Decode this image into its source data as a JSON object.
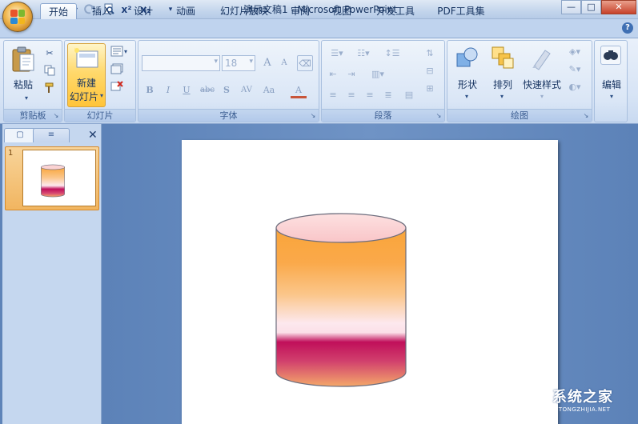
{
  "window": {
    "title": "演示文稿1 - Microsoft PowerPoint",
    "minimize_glyph": "—",
    "restore_glyph": "□",
    "close_glyph": "✕"
  },
  "qat": {
    "icons": [
      "save-icon",
      "undo-icon",
      "redo-icon",
      "print-preview-icon",
      "superscript-icon",
      "subscript-icon",
      "customize-qat-icon"
    ],
    "superscript_label": "x²",
    "subscript_label": "x₂"
  },
  "tabs": [
    {
      "label": "开始",
      "active": true
    },
    {
      "label": "插入"
    },
    {
      "label": "设计"
    },
    {
      "label": "动画"
    },
    {
      "label": "幻灯片放映"
    },
    {
      "label": "审阅"
    },
    {
      "label": "视图"
    },
    {
      "label": "开发工具"
    },
    {
      "label": "PDF工具集"
    }
  ],
  "help_glyph": "?",
  "ribbon": {
    "clipboard": {
      "label": "剪贴板",
      "paste_label": "粘贴"
    },
    "slides": {
      "label": "幻灯片",
      "new_slide_line1": "新建",
      "new_slide_line2": "幻灯片"
    },
    "font": {
      "label": "字体",
      "font_name": "",
      "font_size": "18",
      "grow_label": "A",
      "shrink_label": "A",
      "bold": "B",
      "italic": "I",
      "underline": "U",
      "strike": "abc",
      "shadow": "S",
      "spacing": "AV",
      "case": "Aa",
      "color": "A"
    },
    "paragraph": {
      "label": "段落"
    },
    "drawing": {
      "label": "绘图",
      "shapes_label": "形状",
      "arrange_label": "排列",
      "quick_styles_label": "快速样式"
    },
    "editing": {
      "label": "编辑"
    }
  },
  "panel": {
    "tab_slides_glyph": "▢",
    "tab_outline_glyph": "≡",
    "close_glyph": "✕",
    "slide_number": "1"
  },
  "slide_shape": {
    "type": "cylinder",
    "colors": {
      "top": "#fbd3d3",
      "orange": "#f9a53a",
      "light": "#fde8ee",
      "magenta": "#c00f5a",
      "bottom": "#f4a86a",
      "outline": "#6d6d7d"
    }
  },
  "watermark": {
    "text": "系统之家",
    "subtext": "XITONGZHIJIA.NET"
  }
}
